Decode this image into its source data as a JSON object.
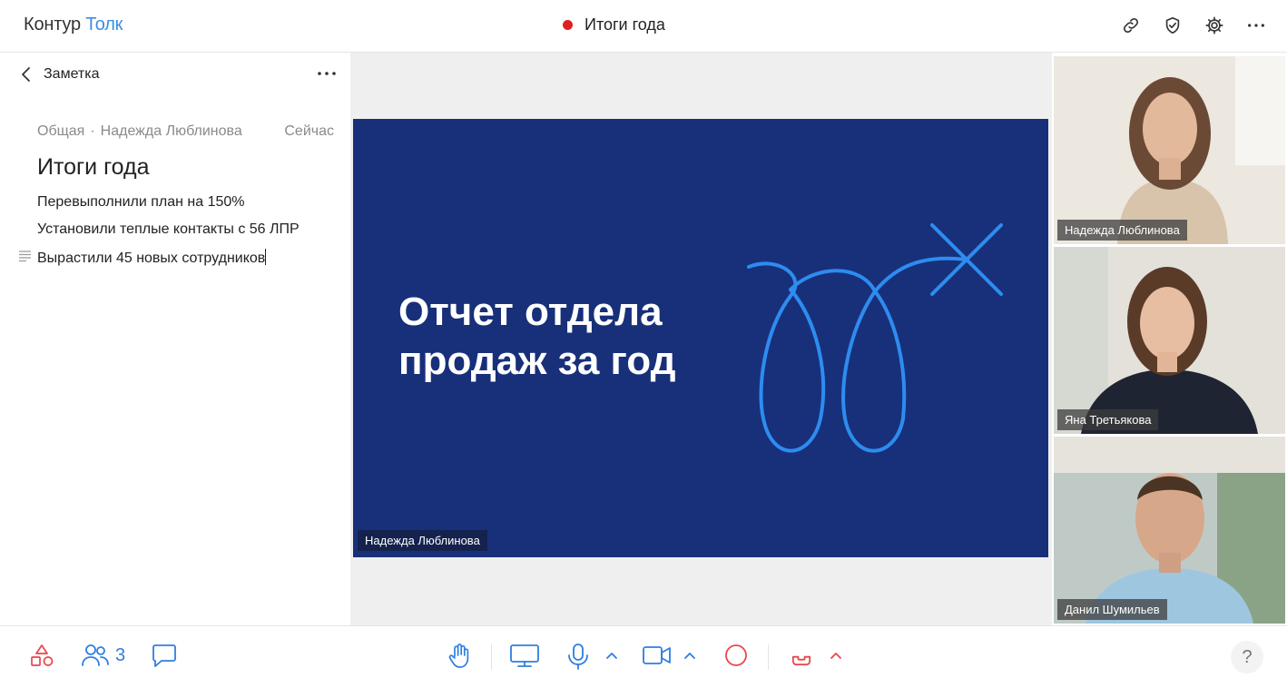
{
  "app": {
    "logo_part1": "Контур",
    "logo_part2": "Толк"
  },
  "meeting": {
    "title": "Итоги года",
    "recording": true
  },
  "header_icons": [
    "link-icon",
    "shield-check-icon",
    "gear-icon",
    "more-icon"
  ],
  "note": {
    "header": "Заметка",
    "category": "Общая",
    "author": "Надежда Люблинова",
    "time": "Сейчас",
    "title": "Итоги года",
    "lines": [
      "Перевыполнили план на 150%",
      "Установили теплые контакты с 56 ЛПР",
      "Вырастили 45 новых сотрудников"
    ]
  },
  "slide": {
    "heading": "Отчет отдела продаж за год",
    "presenter": "Надежда Люблинова",
    "background": "#18307a",
    "accent": "#2d8cf0"
  },
  "participants": [
    {
      "name": "Надежда Люблинова"
    },
    {
      "name": "Яна Третьякова"
    },
    {
      "name": "Данил Шумильев"
    }
  ],
  "toolbar": {
    "participants_count": "3",
    "help": "?",
    "colors": {
      "primary": "#2e7ee0",
      "danger": "#e8464a"
    }
  }
}
